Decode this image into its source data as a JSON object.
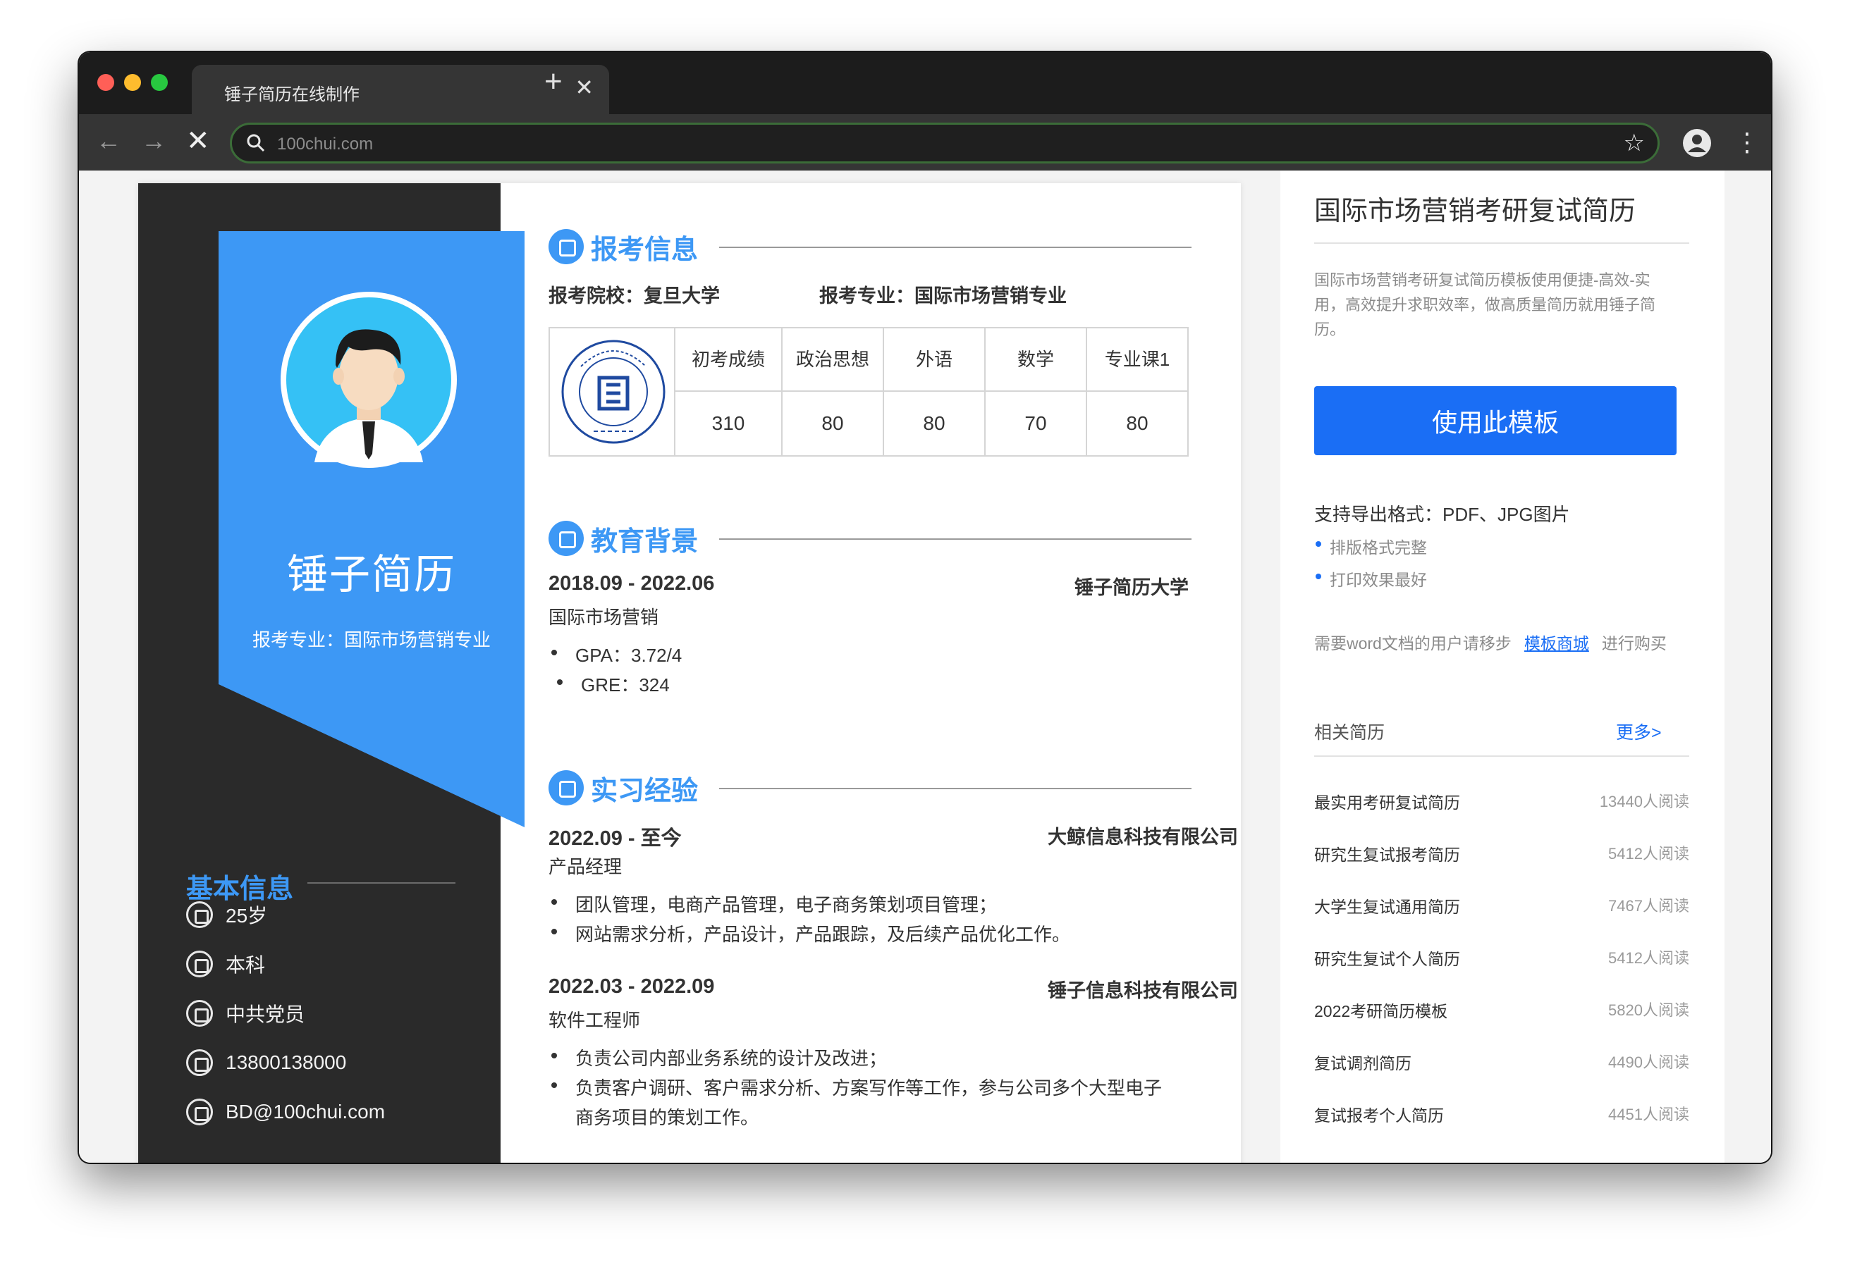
{
  "browser": {
    "tab_title": "锤子简历在线制作",
    "tab_close": "✕",
    "new_tab": "+",
    "url": "100chui.com",
    "nav": {
      "back": "←",
      "forward": "→",
      "stop": "✕"
    },
    "star": "☆",
    "menu": "⋮"
  },
  "resume": {
    "name": "锤子简历",
    "major_line": "报考专业：国际市场营销专业",
    "basic_title": "基本信息",
    "basic_info": [
      {
        "icon": "chart-icon",
        "text": "25岁"
      },
      {
        "icon": "education-icon",
        "text": "本科"
      },
      {
        "icon": "party-icon",
        "text": "中共党员"
      },
      {
        "icon": "phone-icon",
        "text": "13800138000"
      },
      {
        "icon": "mail-icon",
        "text": "BD@100chui.com"
      }
    ],
    "exam": {
      "title": "报考信息",
      "school": "报考院校：复旦大学",
      "major": "报考专业：国际市场营销专业",
      "logo_text": "FUDAN UNIVERSITY 1905",
      "columns": [
        "初考成绩",
        "政治思想",
        "外语",
        "数学",
        "专业课1"
      ],
      "scores": [
        "310",
        "80",
        "80",
        "70",
        "80"
      ]
    },
    "education": {
      "title": "教育背景",
      "period": "2018.09 - 2022.06",
      "school": "锤子简历大学",
      "major": "国际市场营销",
      "bullets": [
        "GPA：3.72/4",
        "GRE：324"
      ]
    },
    "internship": {
      "title": "实习经验",
      "items": [
        {
          "period": "2022.09 - 至今",
          "company": "大鲸信息科技有限公司",
          "role": "产品经理",
          "bullets": [
            "团队管理，电商产品管理，电子商务策划项目管理；",
            "网站需求分析，产品设计，产品跟踪，及后续产品优化工作。"
          ]
        },
        {
          "period": "2022.03 - 2022.09",
          "company": "锤子信息科技有限公司",
          "role": "软件工程师",
          "bullets": [
            "负责公司内部业务系统的设计及改进；",
            "负责客户调研、客户需求分析、方案写作等工作，参与公司多个大型电子",
            "商务项目的策划工作。"
          ]
        }
      ]
    }
  },
  "panel": {
    "title": "国际市场营销考研复试简历",
    "description": "国际市场营销考研复试简历模板使用便捷-高效-实用，高效提升求职效率，做高质量简历就用锤子简历。",
    "use_button": "使用此模板",
    "support": "支持导出格式：PDF、JPG图片",
    "features": [
      "排版格式完整",
      "打印效果最好"
    ],
    "note_before": "需要word文档的用户请移步",
    "note_link": "模板商城",
    "note_after": "进行购买",
    "related_title": "相关简历",
    "more": "更多>",
    "related": [
      {
        "name": "最实用考研复试简历",
        "count": "13440人阅读"
      },
      {
        "name": "研究生复试报考简历",
        "count": "5412人阅读"
      },
      {
        "name": "大学生复试通用简历",
        "count": "7467人阅读"
      },
      {
        "name": "研究生复试个人简历",
        "count": "5412人阅读"
      },
      {
        "name": "2022考研简历模板",
        "count": "5820人阅读"
      },
      {
        "name": "复试调剂简历",
        "count": "4490人阅读"
      },
      {
        "name": "复试报考个人简历",
        "count": "4451人阅读"
      }
    ]
  },
  "colors": {
    "accent": "#3d98f5",
    "button": "#1a6ef5",
    "sidebar": "#2a2a2a"
  }
}
